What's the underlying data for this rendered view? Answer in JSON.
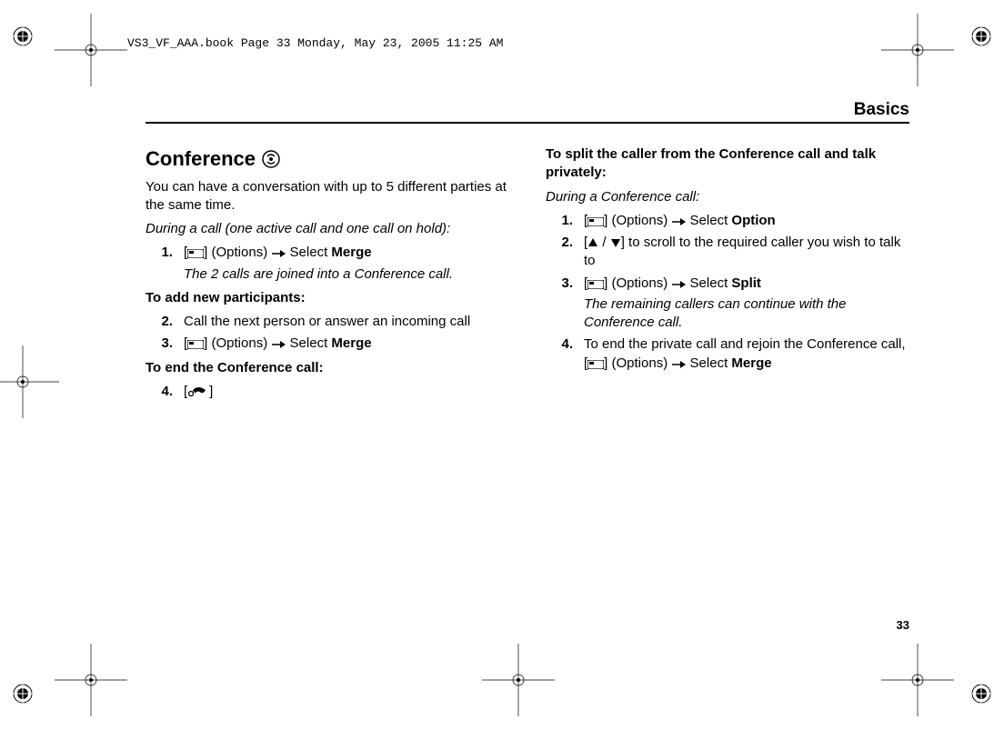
{
  "crop_header": "VS3_VF_AAA.book  Page 33  Monday, May 23, 2005  11:25 AM",
  "section": "Basics",
  "page_number": "33",
  "left": {
    "title": "Conference",
    "intro": "You can have a conversation with up to 5 different parties at the same time.",
    "context": "During a call (one active call and one call on hold):",
    "step1_num": "1.",
    "step1_mid": " (Options) ",
    "step1_after": " Select ",
    "step1_bold": "Merge",
    "step1_result": "The 2 calls are joined into a Conference call.",
    "add_heading": "To add new participants:",
    "step2_num": "2.",
    "step2_text": "Call the next person or answer an incoming call",
    "step3_num": "3.",
    "step3_mid": " (Options) ",
    "step3_after": " Select ",
    "step3_bold": "Merge",
    "end_heading": "To end the Conference call:",
    "step4_num": "4."
  },
  "right": {
    "heading": "To split the caller from the Conference call and talk privately:",
    "context": "During a Conference call:",
    "r1_num": "1.",
    "r1_mid": " (Options) ",
    "r1_after": " Select ",
    "r1_bold": "Option",
    "r2_num": "2.",
    "r2_after": " to scroll to the required caller you wish to talk to",
    "r3_num": "3.",
    "r3_mid": " (Options) ",
    "r3_after": " Select ",
    "r3_bold": "Split",
    "r3_result": "The remaining callers can continue with the Conference call.",
    "r4_num": "4.",
    "r4_before": "To end the private call and rejoin the Conference call, ",
    "r4_mid": " (Options) ",
    "r4_after": " Select ",
    "r4_bold": "Merge"
  }
}
